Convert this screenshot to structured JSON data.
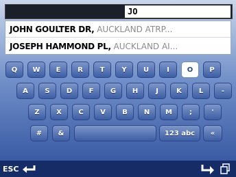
{
  "search": {
    "value": "JO"
  },
  "results": [
    {
      "street": "JOHN GOULTER DR,",
      "city": " AUCKLAND ATRP..."
    },
    {
      "street": "JOSEPH HAMMOND PL,",
      "city": " AUCKLAND AI..."
    }
  ],
  "keyboard": {
    "row1": [
      "Q",
      "W",
      "E",
      "R",
      "T",
      "Y",
      "U",
      "I",
      "O",
      "P"
    ],
    "row2": [
      "A",
      "S",
      "D",
      "F",
      "G",
      "H",
      "J",
      "K",
      "L",
      "-"
    ],
    "row3": [
      "Z",
      "X",
      "C",
      "V",
      "B",
      "N",
      "M",
      ";",
      "'"
    ],
    "row4": {
      "hash": "#",
      "amp": "&",
      "space": "",
      "mode": "123 abc",
      "backspace": "«"
    },
    "selected_key": "O"
  },
  "bottom": {
    "esc_label": "ESC"
  },
  "icons": {
    "back": "enter-arrow-icon",
    "confirm": "return-arrow-icon",
    "copy": "copy-pages-icon"
  },
  "colors": {
    "key_blue": "#4d6db0",
    "bar": "#152c66"
  }
}
